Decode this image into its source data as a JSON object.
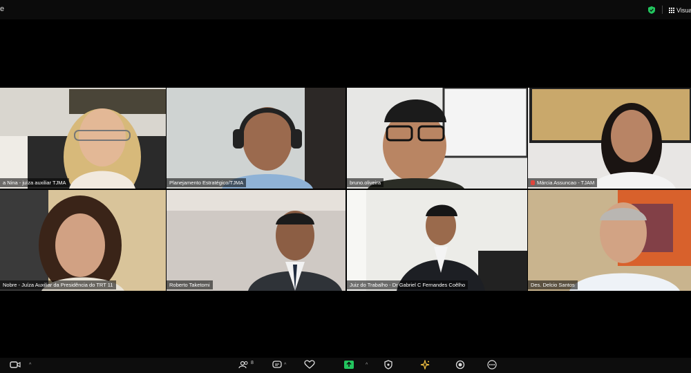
{
  "top_bar": {
    "left_glyph": "e",
    "view_label": "Visuali"
  },
  "participants": [
    {
      "name": "a Nina - juíza auxiliar TJMA",
      "muted": false,
      "active": true
    },
    {
      "name": "Planejamento Estratégico/TJMA",
      "muted": false,
      "active": false
    },
    {
      "name": "bruno.oliveira",
      "muted": false,
      "active": false
    },
    {
      "name": "Márcia Assuncao - TJAM",
      "muted": true,
      "active": false
    },
    {
      "name": "Nobre - Juíza Auxiliar da Presidência do TRT 11",
      "muted": false,
      "active": false
    },
    {
      "name": "Roberto Taketomi",
      "muted": false,
      "active": false
    },
    {
      "name": "Juiz do Trabalho - Dr Gabriel C Fernandes Coêlho",
      "muted": false,
      "active": false
    },
    {
      "name": "Des. Delcio Santos",
      "muted": false,
      "active": false
    }
  ],
  "toolbar": {
    "participants_count": "8",
    "share_color": "#22c55e",
    "items": [
      "camera-icon",
      "participants-icon",
      "chat-icon",
      "react-icon",
      "share-screen-icon",
      "security-icon",
      "ai-companion-icon",
      "record-icon",
      "more-icon"
    ]
  },
  "colors": {
    "active_speaker": "#e9e29a",
    "muted": "#e0453c",
    "shield": "#22c55e"
  }
}
